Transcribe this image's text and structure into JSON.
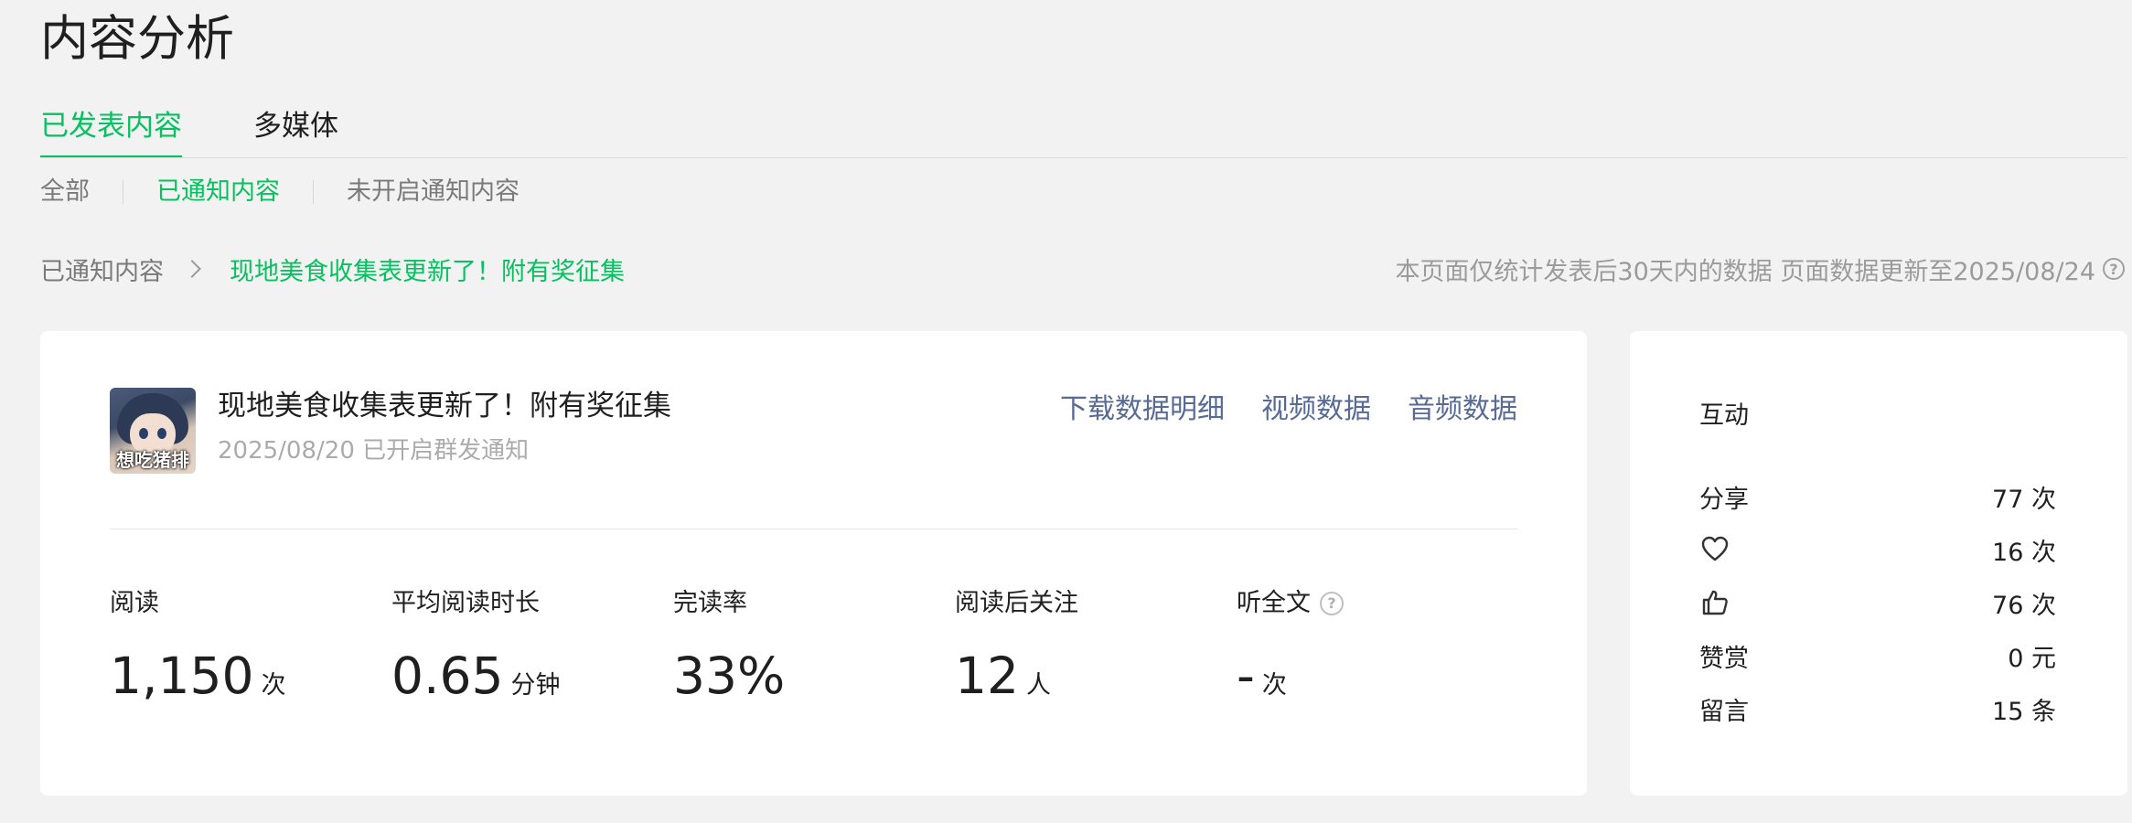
{
  "page_title": "内容分析",
  "main_tabs": [
    {
      "label": "已发表内容",
      "active": true
    },
    {
      "label": "多媒体",
      "active": false
    }
  ],
  "sub_tabs": [
    {
      "label": "全部",
      "active": false
    },
    {
      "label": "已通知内容",
      "active": true
    },
    {
      "label": "未开启通知内容",
      "active": false
    }
  ],
  "breadcrumb": {
    "parent": "已通知内容",
    "current": "现地美食收集表更新了！附有奖征集"
  },
  "page_note": "本页面仅统计发表后30天内的数据 页面数据更新至2025/08/24",
  "article": {
    "thumbnail_caption": "想吃猪排",
    "title": "现地美食收集表更新了！附有奖征集",
    "subtitle": "2025/08/20 已开启群发通知",
    "actions": [
      "下载数据明细",
      "视频数据",
      "音频数据"
    ]
  },
  "metrics": [
    {
      "label": "阅读",
      "value": "1,150",
      "unit": "次"
    },
    {
      "label": "平均阅读时长",
      "value": "0.65",
      "unit": "分钟"
    },
    {
      "label": "完读率",
      "value": "33%",
      "unit": ""
    },
    {
      "label": "阅读后关注",
      "value": "12",
      "unit": "人"
    },
    {
      "label": "听全文",
      "value": "-",
      "unit": "次",
      "help": "?"
    }
  ],
  "interaction": {
    "title": "互动",
    "rows": [
      {
        "label": "分享",
        "icon": null,
        "value": "77 次"
      },
      {
        "label": "",
        "icon": "heart-icon",
        "value": "16 次"
      },
      {
        "label": "",
        "icon": "thumbs-up-icon",
        "value": "76 次"
      },
      {
        "label": "赞赏",
        "icon": null,
        "value": "0 元"
      },
      {
        "label": "留言",
        "icon": null,
        "value": "15 条"
      }
    ]
  },
  "colors": {
    "accent": "#07c160",
    "link": "#576b95",
    "muted": "#9b9b9b",
    "background": "#f2f2f2"
  }
}
